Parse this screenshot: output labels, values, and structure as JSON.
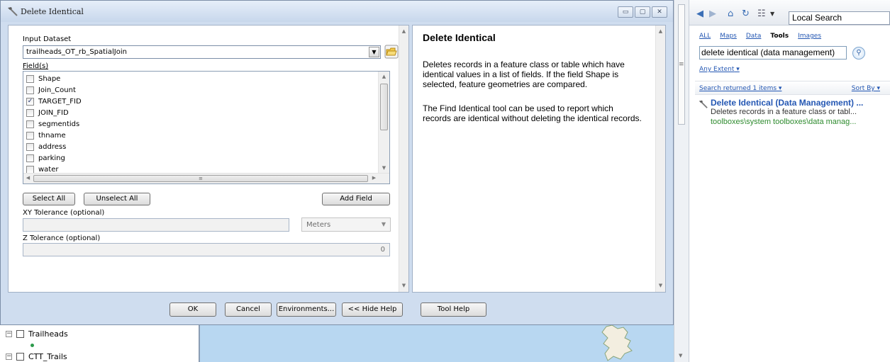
{
  "dialog": {
    "title": "Delete Identical",
    "window_buttons": {
      "minimize": "▭",
      "maximize": "▢",
      "close": "✕"
    }
  },
  "form": {
    "input_dataset_label": "Input Dataset",
    "input_dataset_value": "trailheads_OT_rb_SpatialJoin",
    "fields_label": "Field(s)",
    "fields": [
      {
        "name": "Shape",
        "checked": false
      },
      {
        "name": "Join_Count",
        "checked": false
      },
      {
        "name": "TARGET_FID",
        "checked": true
      },
      {
        "name": "JOIN_FID",
        "checked": false
      },
      {
        "name": "segmentids",
        "checked": false
      },
      {
        "name": "thname",
        "checked": false
      },
      {
        "name": "address",
        "checked": false
      },
      {
        "name": "parking",
        "checked": false
      },
      {
        "name": "water",
        "checked": false
      }
    ],
    "select_all": "Select All",
    "unselect_all": "Unselect All",
    "add_field": "Add Field",
    "xy_tolerance_label": "XY Tolerance (optional)",
    "xy_tolerance_value": "",
    "xy_units": "Meters",
    "z_tolerance_label": "Z Tolerance (optional)",
    "z_tolerance_value": "0"
  },
  "help": {
    "title": "Delete Identical",
    "paragraph1": "Deletes records in a feature class or table which have identical values in a list of fields. If the field Shape is selected, feature geometries are compared.",
    "paragraph2": "The Find Identical tool can be used to report which records are identical without deleting the identical records."
  },
  "buttons": {
    "ok": "OK",
    "cancel": "Cancel",
    "environments": "Environments...",
    "hide_help": "<< Hide Help",
    "tool_help": "Tool Help"
  },
  "toc": {
    "layers": [
      "Trailheads",
      "CTT_Trails"
    ]
  },
  "search": {
    "local_search": "Local Search",
    "filters": [
      "ALL",
      "Maps",
      "Data",
      "Tools",
      "Images"
    ],
    "active_filter": "Tools",
    "query": "delete identical (data management)",
    "extent": "Any Extent",
    "results_count": "Search returned 1 items",
    "sort_by": "Sort By",
    "result": {
      "title": "Delete Identical (Data Management) ...",
      "description": "Deletes records in a feature class or tabl...",
      "path": "toolboxes\\system toolboxes\\data manag..."
    }
  },
  "colors": {
    "dialog_bg": "#cfddef",
    "link_blue": "#2457b3",
    "path_green": "#2e8b2e",
    "map_water": "#b8d7f1"
  }
}
